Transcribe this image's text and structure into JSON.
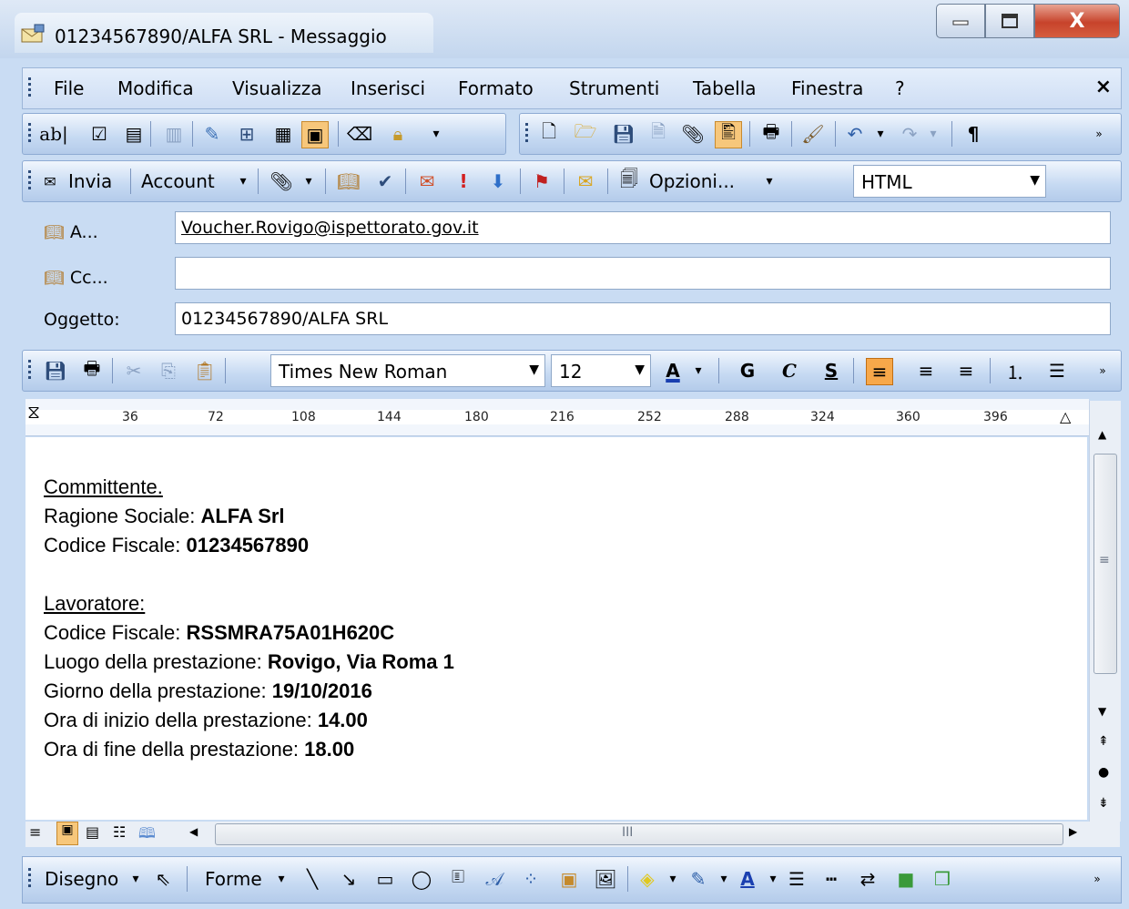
{
  "window": {
    "title": "01234567890/ALFA SRL - Messaggio",
    "minimize_icon": "minimize-icon",
    "maximize_icon": "maximize-icon",
    "close_label": "X"
  },
  "menu": {
    "items": [
      "File",
      "Modifica",
      "Visualizza",
      "Inserisci",
      "Formato",
      "Strumenti",
      "Tabella",
      "Finestra",
      "?"
    ],
    "close_label": "×"
  },
  "toolbar1": {
    "icons": [
      "text-field-icon",
      "checkbox-icon",
      "list-box-icon",
      "properties-icon",
      "edit-icon",
      "table-icon",
      "grid-icon",
      "text-highlight-icon",
      "eraser-icon",
      "lock-icon",
      "new-icon",
      "open-icon",
      "save-icon",
      "print-preview-icon",
      "attach-icon",
      "signature-icon",
      "print-icon",
      "format-painter-icon",
      "undo-icon",
      "redo-icon"
    ],
    "pilcrow": "¶"
  },
  "toolbar2": {
    "send_label": "Invia",
    "account_label": "Account",
    "options_label": "Opzioni...",
    "format_value": "HTML"
  },
  "header": {
    "to_label": "A...",
    "to_value": "Voucher.Rovigo@ispettorato.gov.it",
    "cc_label": "Cc...",
    "cc_value": "",
    "subject_label": "Oggetto:",
    "subject_value": "01234567890/ALFA SRL"
  },
  "format_toolbar": {
    "font": "Times New Roman",
    "size": "12",
    "bold": "G",
    "italic": "C",
    "underline": "S",
    "font_color_letter": "A"
  },
  "ruler": {
    "ticks": [
      "36",
      "72",
      "108",
      "144",
      "180",
      "216",
      "252",
      "288",
      "324",
      "360",
      "396"
    ]
  },
  "message": {
    "section1_title": "Committente.",
    "ragione_label": "Ragione Sociale: ",
    "ragione_value": "ALFA Srl",
    "cf1_label": "Codice Fiscale: ",
    "cf1_value": "01234567890",
    "section2_title": "Lavoratore:",
    "cf2_label": "Codice Fiscale: ",
    "cf2_value": "RSSMRA75A01H620C",
    "luogo_label": "Luogo della prestazione: ",
    "luogo_value": "Rovigo, Via Roma 1",
    "giorno_label": "Giorno della prestazione: ",
    "giorno_value": "19/10/2016",
    "inizio_label": "Ora di inizio della prestazione: ",
    "inizio_value": "14.00",
    "fine_label": "Ora di fine della prestazione: ",
    "fine_value": "18.00"
  },
  "hscroll": {
    "center_mark": "III"
  },
  "drawing_toolbar": {
    "draw_label": "Disegno",
    "shapes_label": "Forme"
  }
}
